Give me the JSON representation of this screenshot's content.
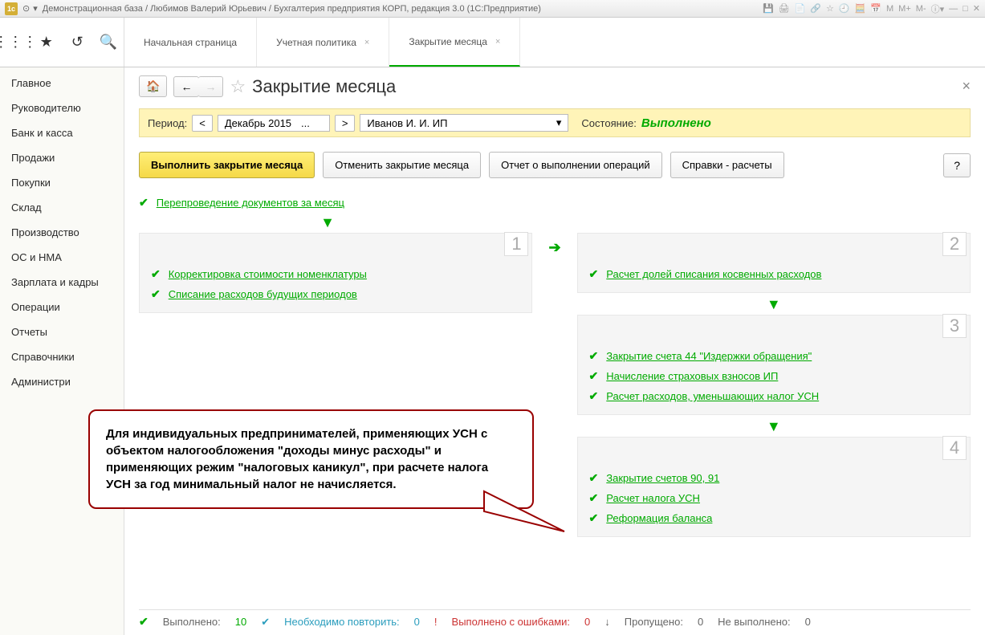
{
  "title_bar": "Демонстрационная база / Любимов Валерий Юрьевич / Бухгалтерия предприятия КОРП, редакция 3.0  (1С:Предприятие)",
  "tabs": [
    {
      "label": "Начальная страница",
      "closable": false
    },
    {
      "label": "Учетная политика",
      "closable": true
    },
    {
      "label": "Закрытие месяца",
      "closable": true,
      "active": true
    }
  ],
  "sidebar": {
    "items": [
      "Главное",
      "Руководителю",
      "Банк и касса",
      "Продажи",
      "Покупки",
      "Склад",
      "Производство",
      "ОС и НМА",
      "Зарплата и кадры",
      "Операции",
      "Отчеты",
      "Справочники",
      "Администри"
    ]
  },
  "page": {
    "title": "Закрытие месяца",
    "period_label": "Период:",
    "period_value": "Декабрь 2015",
    "org_value": "Иванов И. И. ИП",
    "status_label": "Состояние:",
    "status_value": "Выполнено"
  },
  "actions": {
    "execute": "Выполнить закрытие месяца",
    "cancel": "Отменить закрытие месяца",
    "report": "Отчет о выполнении операций",
    "refs": "Справки - расчеты",
    "help": "?"
  },
  "ops": {
    "top": "Перепроведение документов за месяц",
    "stage1_num": "1",
    "stage1_items": [
      "Корректировка стоимости номенклатуры",
      "Списание расходов будущих периодов"
    ],
    "stage2_num": "2",
    "stage2_items": [
      "Расчет долей списания косвенных расходов"
    ],
    "stage3_num": "3",
    "stage3_items": [
      "Закрытие счета 44 \"Издержки обращения\"",
      "Начисление страховых взносов ИП",
      "Расчет расходов, уменьшающих налог УСН"
    ],
    "stage4_num": "4",
    "stage4_items": [
      "Закрытие счетов 90, 91",
      "Расчет налога УСН",
      "Реформация баланса"
    ]
  },
  "callout": "Для индивидуальных предпринимателей, применяющих УСН с объектом налогообложения \"доходы минус расходы\" и применяющих режим \"налоговых каникул\", при расчете налога УСН за год минимальный налог не начисляется.",
  "footer": {
    "done_label": "Выполнено:",
    "done_count": "10",
    "repeat_label": "Необходимо повторить:",
    "repeat_count": "0",
    "errors_label": "Выполнено с ошибками:",
    "errors_count": "0",
    "skipped_label": "Пропущено:",
    "skipped_count": "0",
    "notexec_label": "Не выполнено:",
    "notexec_count": "0"
  },
  "win_icons": {
    "m": "M",
    "mplus": "M+",
    "mminus": "M-"
  }
}
